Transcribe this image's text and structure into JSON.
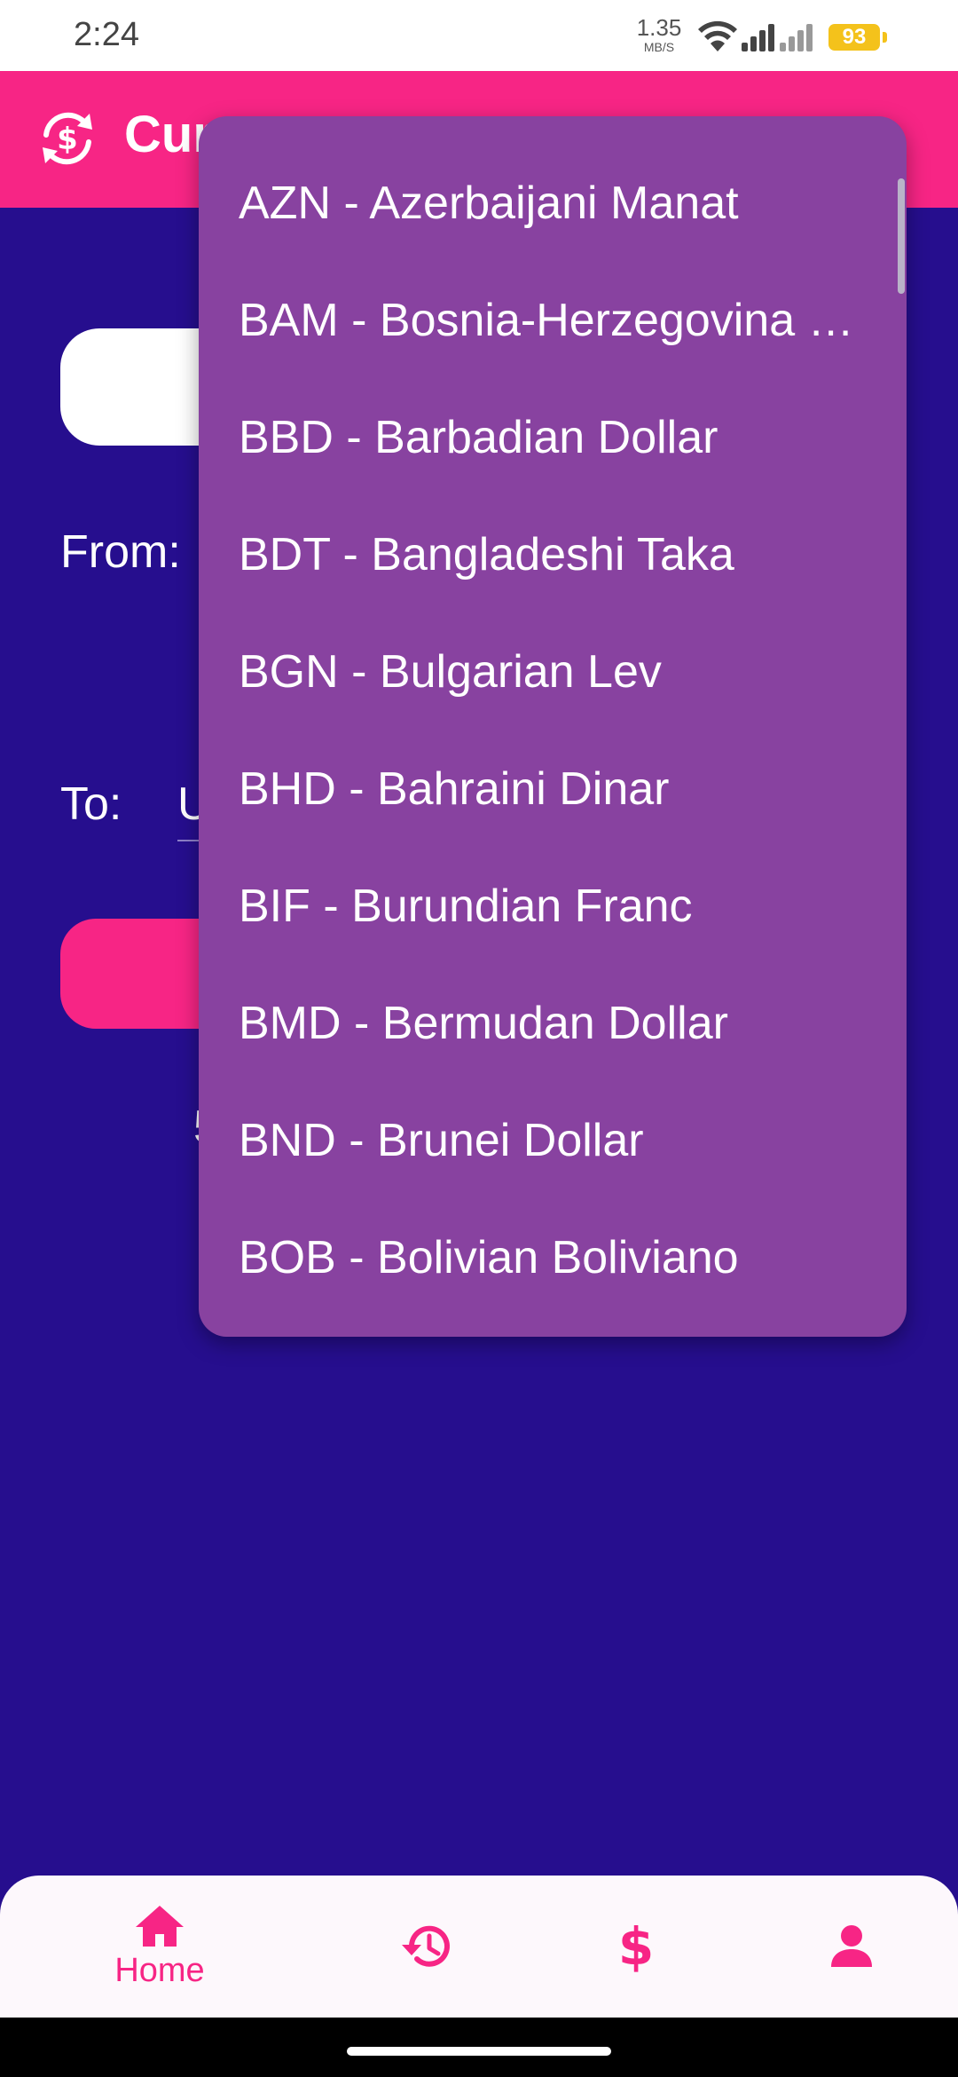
{
  "status_bar": {
    "time": "2:24",
    "net_speed": "1.35",
    "net_unit": "MB/S",
    "battery": "93",
    "battery_color": "#f4c21b"
  },
  "app_bar": {
    "title": "Cur",
    "icon": "currency-exchange-icon",
    "color": "#f72585"
  },
  "form": {
    "from_label": "From:",
    "to_label": "To:",
    "to_value": "U",
    "result_text": "5"
  },
  "dropdown": {
    "background": "#8842a0",
    "items": [
      {
        "label": "AZN - Azerbaijani Manat"
      },
      {
        "label": "BAM - Bosnia-Herzegovina …"
      },
      {
        "label": "BBD - Barbadian Dollar"
      },
      {
        "label": "BDT - Bangladeshi Taka"
      },
      {
        "label": "BGN - Bulgarian Lev"
      },
      {
        "label": "BHD - Bahraini Dinar"
      },
      {
        "label": "BIF - Burundian Franc"
      },
      {
        "label": "BMD - Bermudan Dollar"
      },
      {
        "label": "BND - Brunei Dollar"
      },
      {
        "label": "BOB - Bolivian Boliviano"
      }
    ]
  },
  "bottom_nav": {
    "items": [
      {
        "label": "Home",
        "icon": "home-icon"
      },
      {
        "label": "",
        "icon": "history-icon"
      },
      {
        "label": "",
        "icon": "dollar-icon"
      },
      {
        "label": "",
        "icon": "person-icon"
      }
    ]
  },
  "colors": {
    "background": "#260e8e",
    "accent": "#f72585"
  }
}
